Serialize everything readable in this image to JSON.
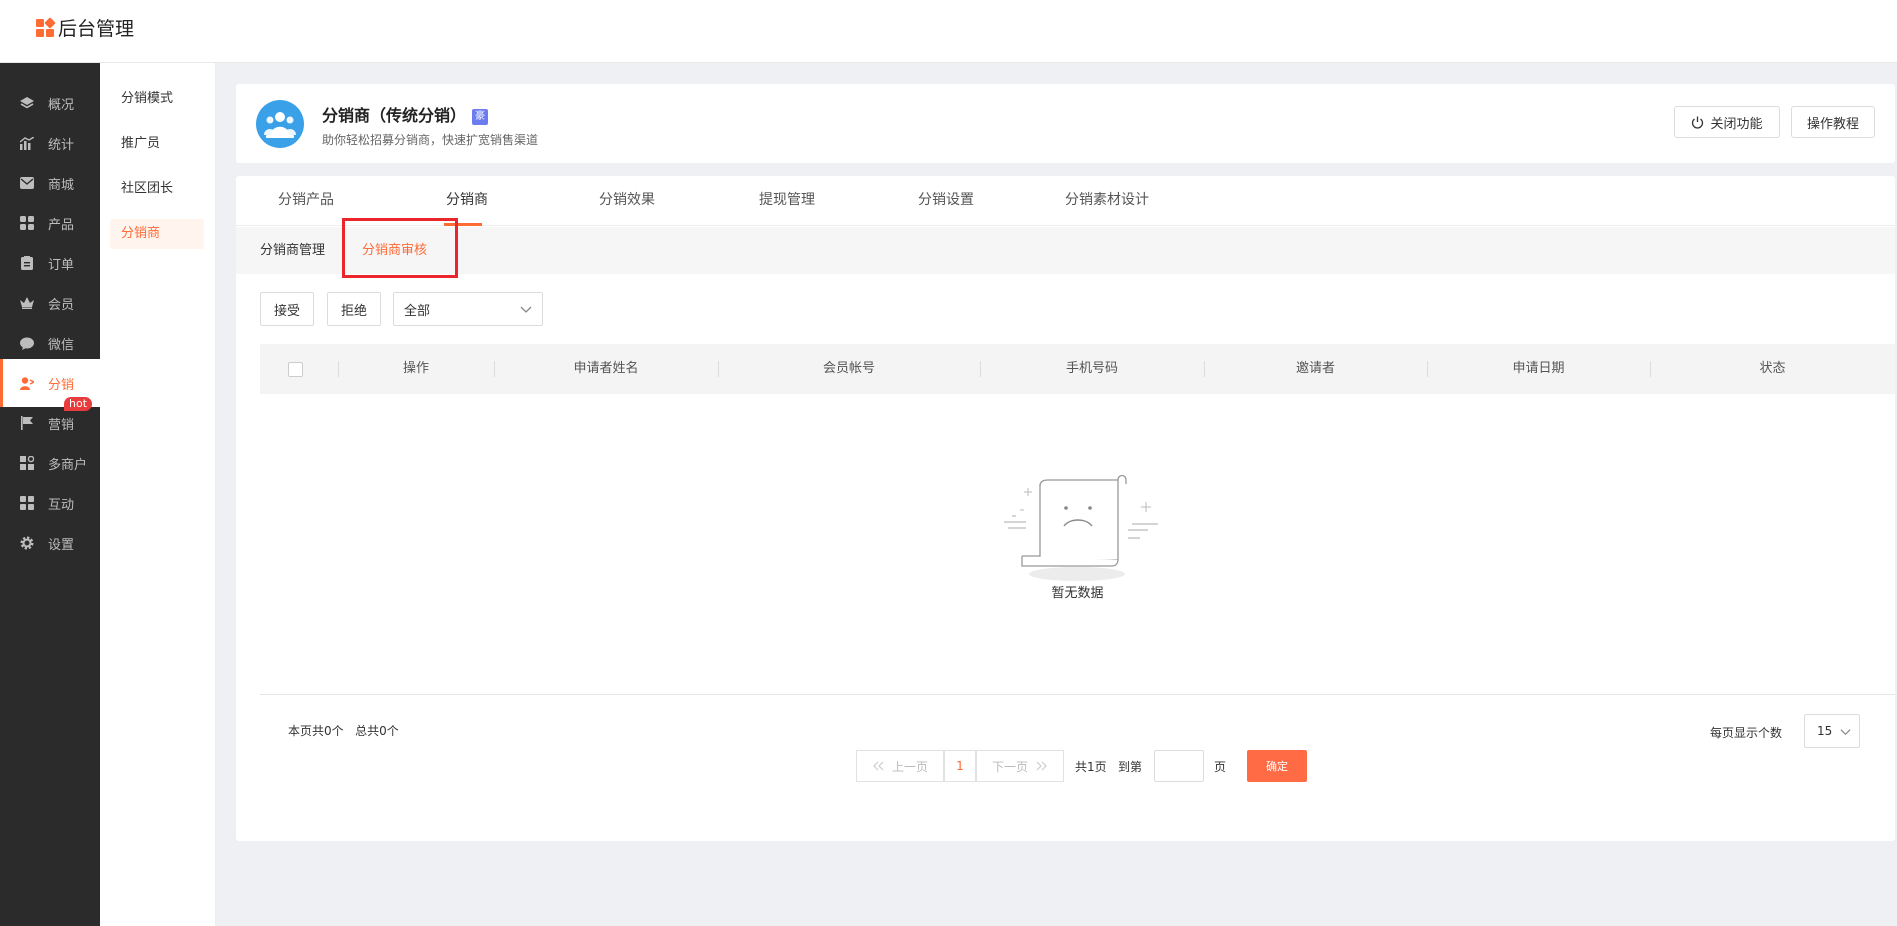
{
  "app": {
    "title": "后台管理"
  },
  "sidebar": {
    "items": [
      {
        "label": "概况",
        "icon": "layers-icon"
      },
      {
        "label": "统计",
        "icon": "chart-icon"
      },
      {
        "label": "商城",
        "icon": "mail-icon"
      },
      {
        "label": "产品",
        "icon": "grid-icon"
      },
      {
        "label": "订单",
        "icon": "clipboard-icon"
      },
      {
        "label": "会员",
        "icon": "crown-icon"
      },
      {
        "label": "微信",
        "icon": "chat-icon"
      },
      {
        "label": "分销",
        "icon": "user-icon",
        "active": true
      },
      {
        "label": "营销",
        "icon": "flag-icon",
        "badge": "hot"
      },
      {
        "label": "多商户",
        "icon": "store-icon"
      },
      {
        "label": "互动",
        "icon": "apps-icon"
      },
      {
        "label": "设置",
        "icon": "gear-icon"
      }
    ]
  },
  "subnav": {
    "items": [
      {
        "label": "分销模式"
      },
      {
        "label": "推广员"
      },
      {
        "label": "社区团长"
      },
      {
        "label": "分销商",
        "active": true
      }
    ]
  },
  "header": {
    "title": "分销商（传统分销）",
    "tag": "豪",
    "description": "助你轻松招募分销商，快速扩宽销售渠道",
    "close_button": "关闭功能",
    "tutorial_button": "操作教程"
  },
  "tabs": [
    "分销产品",
    "分销商",
    "分销效果",
    "提现管理",
    "分销设置",
    "分销素材设计"
  ],
  "active_tab": "分销商",
  "subtabs": [
    "分销商管理",
    "分销商审核"
  ],
  "active_subtab": "分销商审核",
  "toolbar": {
    "accept": "接受",
    "reject": "拒绝",
    "filter_value": "全部"
  },
  "table": {
    "columns": [
      "操作",
      "申请者姓名",
      "会员帐号",
      "手机号码",
      "邀请者",
      "申请日期",
      "状态"
    ],
    "rows": [],
    "empty_text": "暂无数据"
  },
  "pagination": {
    "page_count_text": "本页共0个",
    "total_text": "总共0个",
    "prev": "上一页",
    "current_page": "1",
    "next": "下一页",
    "total_pages": "共1页",
    "goto_label": "到第",
    "page_unit": "页",
    "confirm": "确定",
    "page_size_label": "每页显示个数",
    "page_size": "15"
  },
  "colors": {
    "accent": "#ff6b35",
    "sidebar_bg": "#2b2b2b",
    "highlight": "#e8262b"
  }
}
